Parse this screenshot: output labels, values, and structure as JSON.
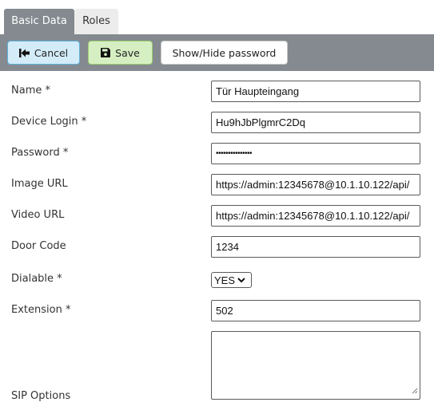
{
  "tabs": [
    {
      "label": "Basic Data",
      "active": true
    },
    {
      "label": "Roles",
      "active": false
    }
  ],
  "toolbar": {
    "cancel_label": "Cancel",
    "cancel_icon": "back-to-start-icon",
    "save_label": "Save",
    "save_icon": "floppy-disk-icon",
    "toggle_password_label": "Show/Hide password"
  },
  "form": {
    "name": {
      "label": "Name *",
      "value": "Tür Haupteingang"
    },
    "device_login": {
      "label": "Device Login *",
      "value": "Hu9hJbPlgmrC2Dq"
    },
    "password": {
      "label": "Password *",
      "value": "•••••••••••••••"
    },
    "image_url": {
      "label": "Image URL",
      "value": "https://admin:12345678@10.1.10.122/api/"
    },
    "video_url": {
      "label": "Video URL",
      "value": "https://admin:12345678@10.1.10.122/api/"
    },
    "door_code": {
      "label": "Door Code",
      "value": "1234"
    },
    "dialable": {
      "label": "Dialable *",
      "value": "YES"
    },
    "extension": {
      "label": "Extension *",
      "value": "502"
    },
    "sip_options": {
      "label": "SIP Options",
      "value": ""
    }
  },
  "colors": {
    "toolbar_bg": "#848a8f",
    "cancel_bg": "#d3ecf8",
    "cancel_border": "#5fb2de",
    "save_bg": "#d6efc2",
    "save_border": "#9bcf6e"
  }
}
